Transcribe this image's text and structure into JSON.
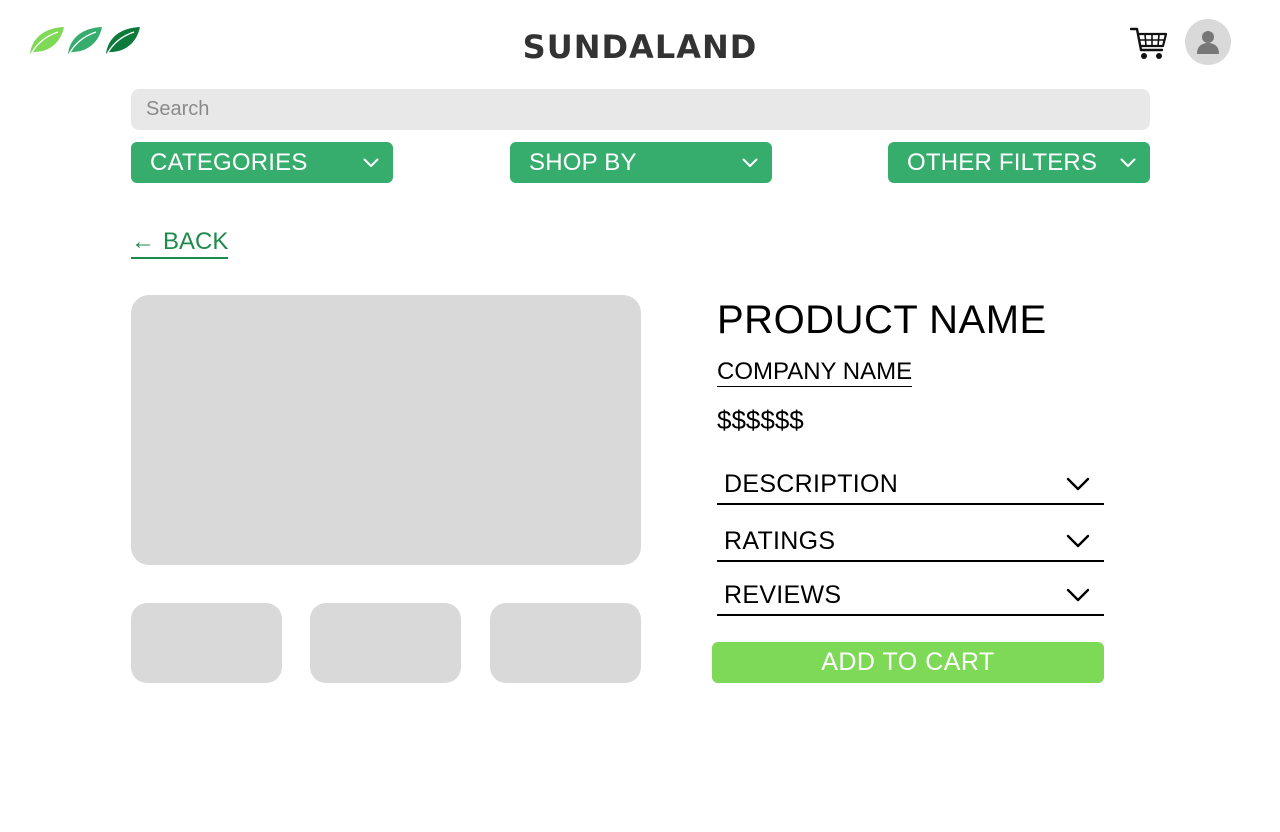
{
  "header": {
    "brand": "SUNDALAND",
    "logo_icon": "leaf-logo-icon",
    "cart_icon": "shopping-cart-icon",
    "avatar_icon": "user-avatar-icon"
  },
  "search": {
    "placeholder": "Search",
    "value": ""
  },
  "filters": [
    {
      "label": "CATEGORIES",
      "icon": "chevron-down-icon"
    },
    {
      "label": "SHOP BY",
      "icon": "chevron-down-icon"
    },
    {
      "label": "OTHER FILTERS",
      "icon": "chevron-down-icon"
    }
  ],
  "back": {
    "arrow": "←",
    "label": "BACK"
  },
  "product": {
    "name": "PRODUCT NAME",
    "company": "COMPANY NAME",
    "price": "$$$$$$",
    "sections": [
      {
        "label": "DESCRIPTION",
        "icon": "chevron-down-icon"
      },
      {
        "label": "RATINGS",
        "icon": "chevron-down-icon"
      },
      {
        "label": "REVIEWS",
        "icon": "chevron-down-icon"
      }
    ],
    "add_to_cart_label": "ADD TO CART"
  },
  "colors": {
    "brand_green": "#36ad6d",
    "link_green": "#1f8a4c",
    "cart_button": "#7ed957",
    "placeholder_gray": "#d9d9d9",
    "search_bg": "#e8e8e8",
    "logo_leaf_light": "#7ed957",
    "logo_leaf_mid": "#36ad6d",
    "logo_leaf_dark": "#0b7a3a"
  }
}
